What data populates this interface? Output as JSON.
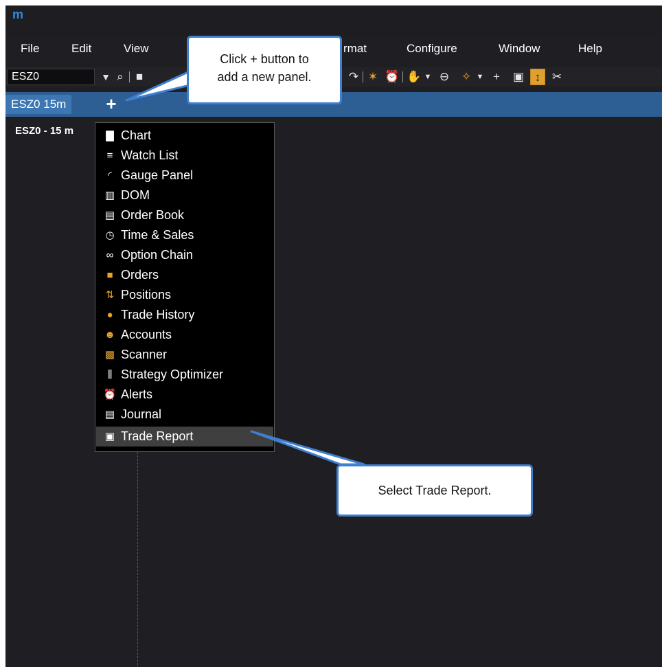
{
  "app": {
    "logo": "m"
  },
  "menu": [
    "File",
    "Edit",
    "View",
    "rmat",
    "Configure",
    "Window",
    "Help"
  ],
  "toolbar": {
    "symbol": "ESZ0",
    "icons": [
      "search-icon",
      "document-icon",
      "redo-icon",
      "draw-tools-icon",
      "alarm-icon",
      "hand-icon",
      "zoom-out-icon",
      "pin-icon",
      "crosshair-icon",
      "lock-icon",
      "scale-icon",
      "link-icon"
    ]
  },
  "tabs": {
    "active_label": "ESZ0 15m",
    "add_label": "+"
  },
  "panel": {
    "title": "ESZ0 - 15 m"
  },
  "dropdown": {
    "items": [
      {
        "label": "Chart",
        "icon": "bar-chart-icon"
      },
      {
        "label": "Watch List",
        "icon": "list-icon"
      },
      {
        "label": "Gauge Panel",
        "icon": "gauge-icon"
      },
      {
        "label": "DOM",
        "icon": "dom-icon"
      },
      {
        "label": "Order Book",
        "icon": "book-icon"
      },
      {
        "label": "Time & Sales",
        "icon": "clock-dollar-icon"
      },
      {
        "label": "Option Chain",
        "icon": "chain-link-icon"
      },
      {
        "label": "Orders",
        "icon": "orders-icon"
      },
      {
        "label": "Positions",
        "icon": "up-down-arrows-icon"
      },
      {
        "label": "Trade History",
        "icon": "history-icon"
      },
      {
        "label": "Accounts",
        "icon": "users-icon"
      },
      {
        "label": "Scanner",
        "icon": "scanner-icon"
      },
      {
        "label": "Strategy Optimizer",
        "icon": "sliders-icon"
      },
      {
        "label": "Alerts",
        "icon": "alarm-clock-icon"
      },
      {
        "label": "Journal",
        "icon": "journal-icon"
      },
      {
        "label": "Trade Report",
        "icon": "image-report-icon"
      }
    ],
    "selected": "Trade Report"
  },
  "callouts": {
    "top": {
      "line1": "Click + button to",
      "line2": "add a new panel."
    },
    "bottom": {
      "text": "Select Trade Report."
    }
  },
  "colors": {
    "accent": "#e0a030",
    "tab_bar": "#2d5f94",
    "callout_border": "#3f7fcf",
    "background": "#1f1f23"
  }
}
